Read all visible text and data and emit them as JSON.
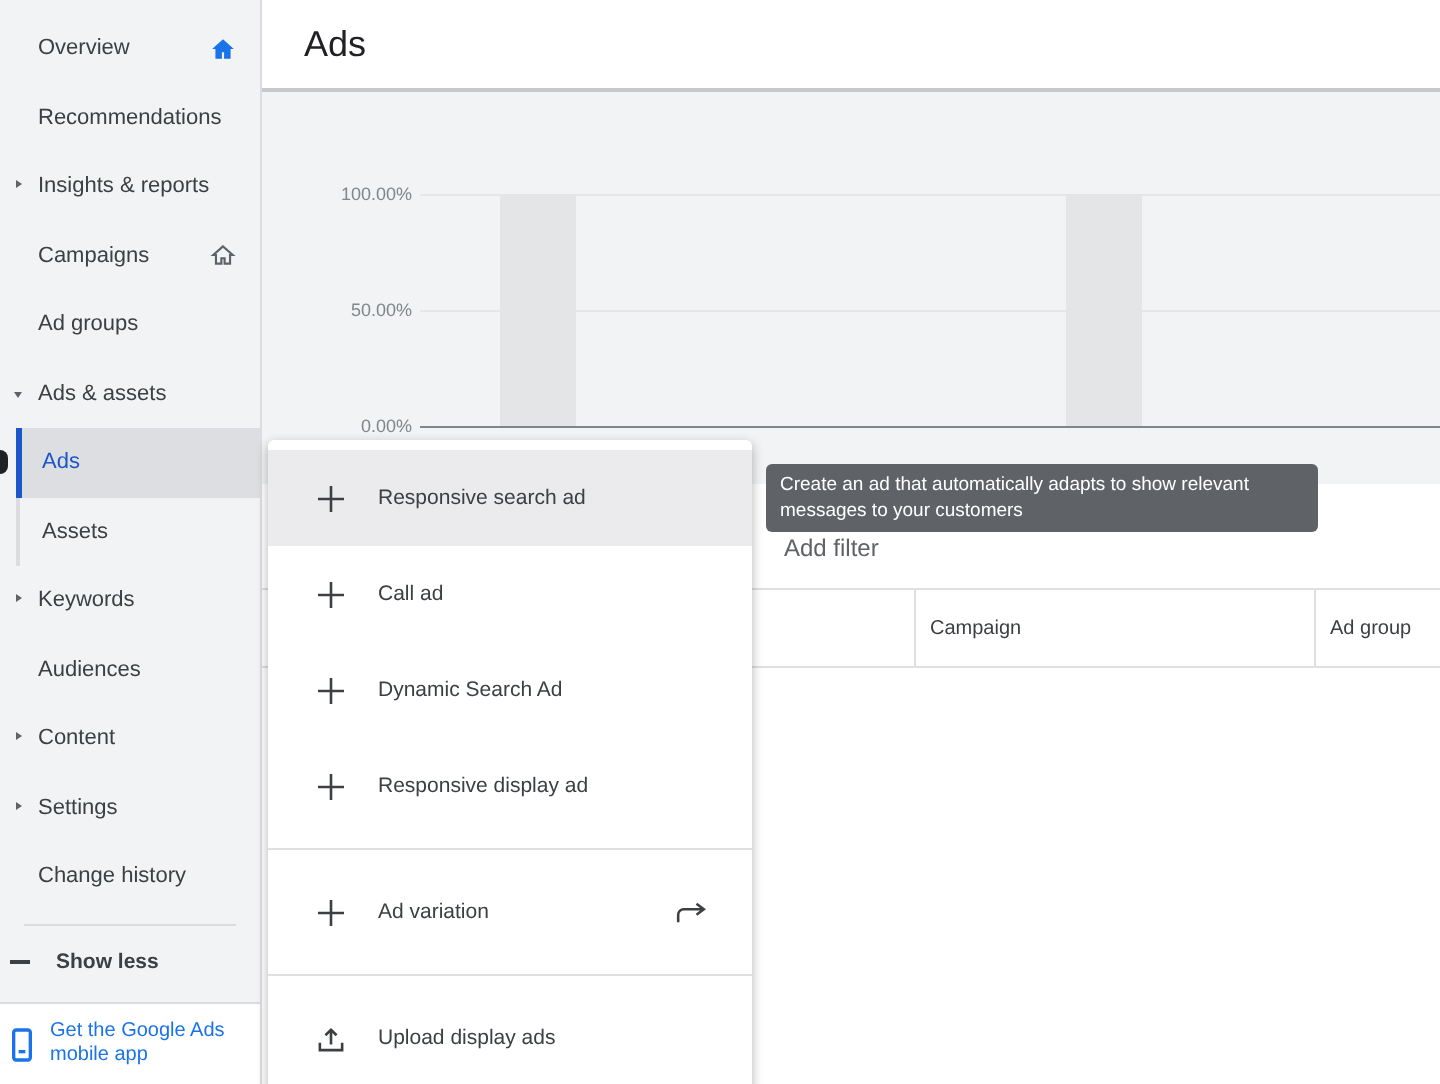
{
  "sidebar": {
    "items": [
      {
        "label": "Overview",
        "kind": "link",
        "selected": false,
        "home": true
      },
      {
        "label": "Recommendations",
        "kind": "link",
        "selected": false
      },
      {
        "label": "Insights & reports",
        "kind": "group",
        "selected": false,
        "expanded": false
      },
      {
        "label": "Campaigns",
        "kind": "link",
        "selected": false,
        "home": false
      },
      {
        "label": "Ad groups",
        "kind": "link",
        "selected": false
      },
      {
        "label": "Ads & assets",
        "kind": "group",
        "selected": false,
        "expanded": true,
        "children": [
          {
            "label": "Ads",
            "selected": true
          },
          {
            "label": "Assets",
            "selected": false
          }
        ]
      },
      {
        "label": "Keywords",
        "kind": "group",
        "selected": false,
        "expanded": false
      },
      {
        "label": "Audiences",
        "kind": "link",
        "selected": false
      },
      {
        "label": "Content",
        "kind": "group",
        "selected": false,
        "expanded": false
      },
      {
        "label": "Settings",
        "kind": "group",
        "selected": false,
        "expanded": false
      },
      {
        "label": "Change history",
        "kind": "link",
        "selected": false
      }
    ],
    "show_less": "Show less",
    "footer": "Get the Google Ads mobile app"
  },
  "page_title": "Ads",
  "chart": {
    "y_ticks": [
      "100.00%",
      "50.00%",
      "0.00%"
    ]
  },
  "filter": {
    "label": "Add filter"
  },
  "table": {
    "columns": [
      "",
      "Campaign",
      "Ad group"
    ]
  },
  "tooltip": "Create an ad that automatically adapts to show relevant messages to your customers",
  "menu": {
    "groups": [
      [
        {
          "label": "Responsive search ad",
          "kind": "add",
          "highlighted": true
        },
        {
          "label": "Call ad",
          "kind": "add",
          "highlighted": false
        },
        {
          "label": "Dynamic Search Ad",
          "kind": "add",
          "highlighted": false
        },
        {
          "label": "Responsive display ad",
          "kind": "add",
          "highlighted": false
        }
      ],
      [
        {
          "label": "Ad variation",
          "kind": "add",
          "highlighted": false,
          "opens_elsewhere": true
        }
      ],
      [
        {
          "label": "Upload display ads",
          "kind": "upload",
          "highlighted": false
        }
      ]
    ]
  }
}
